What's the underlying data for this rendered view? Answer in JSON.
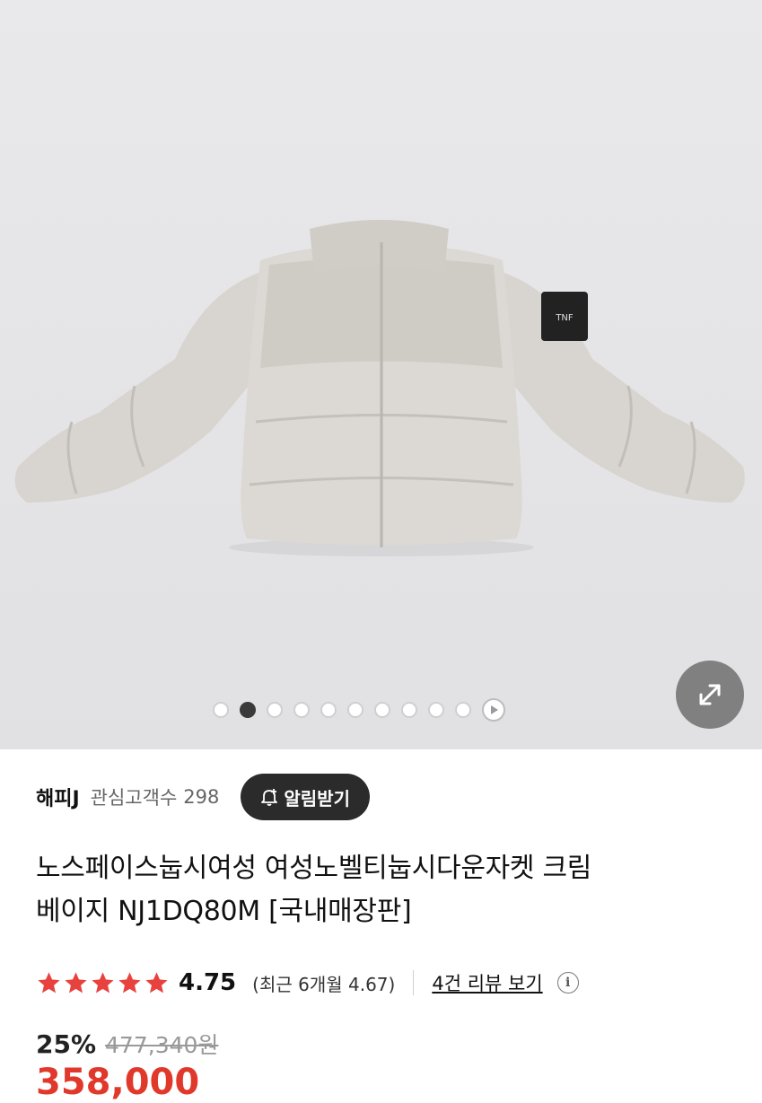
{
  "gallery": {
    "dot_count": 10,
    "active_index": 1,
    "expand_label": "expand-icon",
    "play_label": "play-icon"
  },
  "seller": {
    "name": "해피J",
    "follower_label": "관심고객수",
    "follower_count": "298",
    "alert_button": "알림받기"
  },
  "product": {
    "title_line1": "노스페이스눕시여성 여성노벨티눕시다운자켓 크림",
    "title_line2": "베이지 NJ1DQ80M [국내매장판]"
  },
  "rating": {
    "stars": 5,
    "score": "4.75",
    "recent": "(최근 6개월 4.67)",
    "review_link": "4건 리뷰 보기",
    "info_icon": "i"
  },
  "price": {
    "discount": "25%",
    "original": "477,340원",
    "sale": "358,000"
  },
  "colors": {
    "accent_red": "#e0392b",
    "star_red": "#e8423f",
    "alert_button_bg": "#2b2b2b"
  }
}
